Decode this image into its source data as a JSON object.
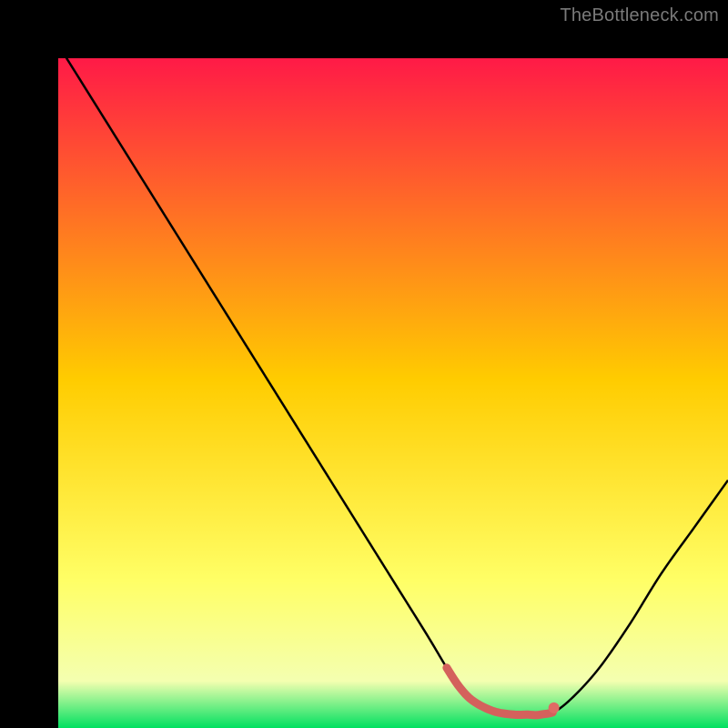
{
  "watermark": "TheBottleneck.com",
  "colors": {
    "gradient_top": "#ff1a47",
    "gradient_mid": "#ffd400",
    "gradient_low": "#ffff80",
    "gradient_bottom": "#00e060",
    "curve": "#000000",
    "marker_stroke": "#d4615c",
    "marker_dot": "#e06a65",
    "frame": "#000000"
  },
  "chart_data": {
    "type": "line",
    "title": "",
    "xlabel": "",
    "ylabel": "",
    "xlim": [
      0,
      100
    ],
    "ylim": [
      0,
      100
    ],
    "x": [
      0,
      5,
      10,
      15,
      20,
      25,
      30,
      35,
      40,
      45,
      50,
      55,
      58,
      60,
      62,
      65,
      68,
      70,
      72,
      75,
      80,
      85,
      90,
      95,
      100
    ],
    "values": [
      102,
      94,
      86,
      78,
      70,
      62,
      54,
      46,
      38,
      30,
      22,
      14,
      9,
      6,
      4,
      2.5,
      2,
      2,
      2,
      3,
      8,
      15,
      23,
      30,
      37
    ],
    "highlight": {
      "x_start": 58,
      "x_end": 74,
      "dot_x": 74,
      "dot_y": 3,
      "color": "#d4615c"
    },
    "annotations": []
  }
}
